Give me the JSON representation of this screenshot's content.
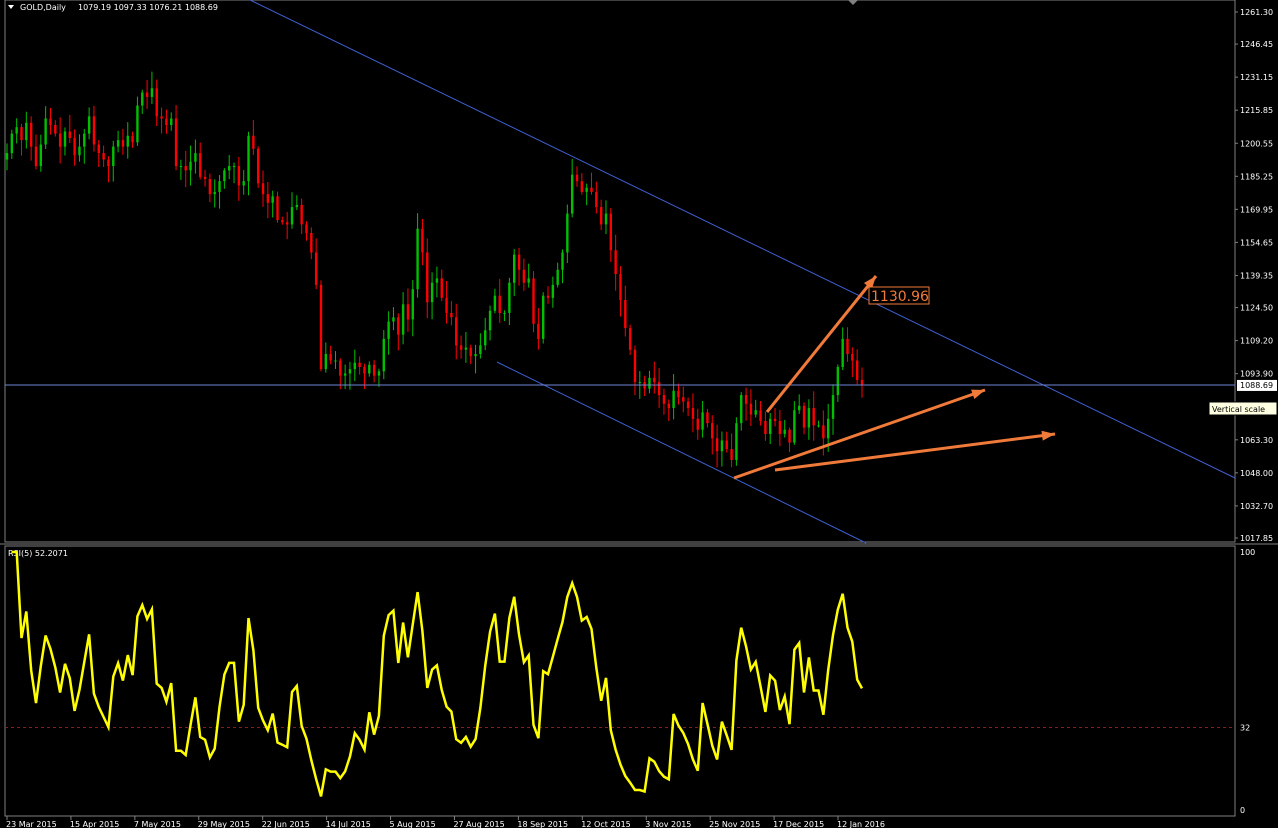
{
  "header": {
    "symbol": "GOLD,Daily",
    "ohlc": "1079.19 1097.33 1076.21 1088.69"
  },
  "rsi_header": "RSI(5) 52.2071",
  "price_label": "1088.69",
  "tooltip": "Vertical scale",
  "target_label": "1130.96",
  "colors": {
    "background": "#000000",
    "bull": "#00c000",
    "bear": "#ff0000",
    "channel": "#3f5fd0",
    "hline": "#6f86d6",
    "arrow": "#f07a3a",
    "rsi": "#ffff00",
    "level": "#8b1a1a",
    "axis": "#c0c0c0"
  },
  "chart_data": [
    {
      "type": "candlestick",
      "title": "GOLD,Daily",
      "y_ticks": [
        "1261.30",
        "1246.45",
        "1231.15",
        "1215.85",
        "1200.55",
        "1185.25",
        "1169.95",
        "1154.65",
        "1139.35",
        "1124.50",
        "1109.20",
        "1093.90",
        "1063.30",
        "1048.00",
        "1032.70",
        "1017.85"
      ],
      "ylim": [
        1014,
        1263
      ],
      "x_ticks": [
        "23 Mar 2015",
        "15 Apr 2015",
        "7 May 2015",
        "29 May 2015",
        "22 Jun 2015",
        "14 Jul 2015",
        "5 Aug 2015",
        "27 Aug 2015",
        "18 Sep 2015",
        "12 Oct 2015",
        "3 Nov 2015",
        "25 Nov 2015",
        "17 Dec 2015",
        "12 Jan 2016"
      ],
      "closes": [
        1196,
        1205,
        1208,
        1202,
        1210,
        1199,
        1190,
        1200,
        1212,
        1209,
        1205,
        1199,
        1206,
        1203,
        1195,
        1199,
        1205,
        1213,
        1200,
        1196,
        1193,
        1190,
        1199,
        1202,
        1199,
        1204,
        1201,
        1218,
        1224,
        1222,
        1226,
        1213,
        1212,
        1209,
        1212,
        1190,
        1190,
        1188,
        1192,
        1196,
        1185,
        1184,
        1177,
        1178,
        1183,
        1188,
        1190,
        1190,
        1181,
        1183,
        1204,
        1198,
        1182,
        1177,
        1173,
        1176,
        1165,
        1164,
        1163,
        1171,
        1172,
        1163,
        1159,
        1150,
        1135,
        1096,
        1103,
        1100,
        1100,
        1093,
        1094,
        1096,
        1099,
        1097,
        1094,
        1098,
        1093,
        1095,
        1110,
        1118,
        1120,
        1112,
        1126,
        1119,
        1133,
        1161,
        1150,
        1127,
        1136,
        1138,
        1129,
        1122,
        1120,
        1107,
        1105,
        1106,
        1102,
        1103,
        1107,
        1114,
        1123,
        1130,
        1122,
        1122,
        1136,
        1149,
        1142,
        1136,
        1138,
        1117,
        1110,
        1130,
        1129,
        1135,
        1142,
        1150,
        1168,
        1186,
        1183,
        1178,
        1180,
        1178,
        1171,
        1163,
        1168,
        1151,
        1140,
        1128,
        1115,
        1105,
        1090,
        1090,
        1087,
        1092,
        1090,
        1084,
        1080,
        1078,
        1086,
        1083,
        1081,
        1078,
        1073,
        1068,
        1076,
        1071,
        1064,
        1058,
        1063,
        1059,
        1054,
        1071,
        1084,
        1080,
        1075,
        1077,
        1072,
        1066,
        1073,
        1072,
        1066,
        1068,
        1062,
        1077,
        1079,
        1069,
        1078,
        1070,
        1070,
        1064,
        1073,
        1084,
        1097,
        1110,
        1103,
        1100,
        1091,
        1088.69
      ],
      "upper_channel": [
        {
          "x": "23 Mar 2015",
          "y": 1285
        },
        {
          "x": "12 Jan 2016",
          "y": 1052
        }
      ],
      "lower_channel": [
        {
          "x": "27 Aug 2015",
          "y": 1099
        },
        {
          "x": "12 Jan 2016",
          "y": 1018
        }
      ],
      "horizontal_line": 1088.69,
      "target": 1130.96
    },
    {
      "type": "line",
      "title": "RSI(5) 52.2071",
      "y_ticks": [
        "100",
        "32",
        "0"
      ],
      "ylim": [
        0,
        100
      ],
      "level": 32,
      "last_value": 52.2071
    }
  ]
}
